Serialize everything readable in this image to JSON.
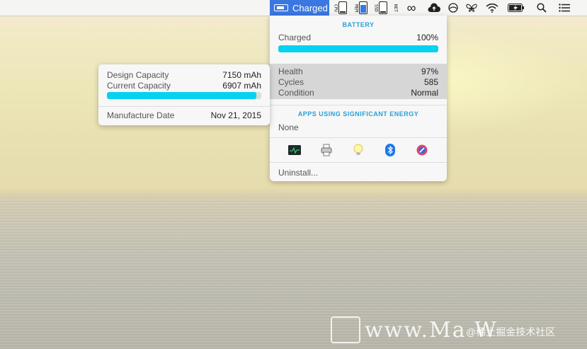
{
  "menubar": {
    "app_status": "Charged",
    "meters": [
      {
        "label": "CPU",
        "level": 0.1,
        "color": "#222222"
      },
      {
        "label": "MEM",
        "level": 0.7,
        "color": "#3b77e0"
      },
      {
        "label": "SSD",
        "level": 0.15,
        "color": "#222222"
      },
      {
        "label": "NET",
        "level": 0.6,
        "color": "#3b77e0"
      }
    ],
    "icons": [
      "infinity-icon",
      "cloud-upload-icon",
      "circle-slash-icon",
      "butterfly-icon",
      "wifi-icon",
      "battery-icon",
      "search-icon",
      "list-icon"
    ]
  },
  "battery_popup": {
    "section_title": "BATTERY",
    "charged_label": "Charged",
    "charged_value": "100%",
    "charged_level": 1.0,
    "health_label": "Health",
    "health_value": "97%",
    "cycles_label": "Cycles",
    "cycles_value": "585",
    "condition_label": "Condition",
    "condition_value": "Normal",
    "apps_title": "APPS USING SIGNIFICANT ENERGY",
    "apps_value": "None",
    "app_icons": [
      "activity-monitor-icon",
      "printer-icon",
      "bulb-icon",
      "bluetooth-icon",
      "color-picker-icon"
    ],
    "uninstall_label": "Uninstall..."
  },
  "capacity_popup": {
    "design_label": "Design Capacity",
    "design_value": "7150 mAh",
    "current_label": "Current Capacity",
    "current_value": "6907 mAh",
    "capacity_level": 0.966,
    "manufacture_label": "Manufacture Date",
    "manufacture_value": "Nov 21, 2015"
  },
  "watermark": {
    "text": "www.Ma  W",
    "text2": "@稀土掘金技术社区"
  },
  "colors": {
    "accent": "#3b77e0",
    "bar": "#06d2f0",
    "section_title": "#2a9fd6"
  }
}
